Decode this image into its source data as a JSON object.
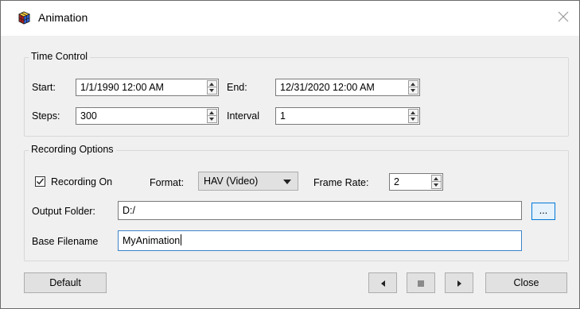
{
  "window": {
    "title": "Animation"
  },
  "time_control": {
    "legend": "Time Control",
    "start_label": "Start:",
    "start_value": "1/1/1990 12:00 AM",
    "end_label": "End:",
    "end_value": "12/31/2020 12:00 AM",
    "steps_label": "Steps:",
    "steps_value": "300",
    "interval_label": "Interval",
    "interval_value": "1"
  },
  "recording_options": {
    "legend": "Recording Options",
    "recording_on_label": "Recording On",
    "recording_on_checked": true,
    "format_label": "Format:",
    "format_value": "HAV (Video)",
    "frame_rate_label": "Frame Rate:",
    "frame_rate_value": "2",
    "output_folder_label": "Output Folder:",
    "output_folder_value": "D:/",
    "browse_label": "...",
    "base_filename_label": "Base Filename",
    "base_filename_value": "MyAnimation"
  },
  "buttons": {
    "default_label": "Default",
    "close_label": "Close",
    "prev_icon": "triangle-left-icon",
    "stop_icon": "stop-square-icon",
    "next_icon": "triangle-right-icon"
  },
  "colors": {
    "focus_border": "#3c84c9",
    "browse_border": "#0078d7"
  }
}
